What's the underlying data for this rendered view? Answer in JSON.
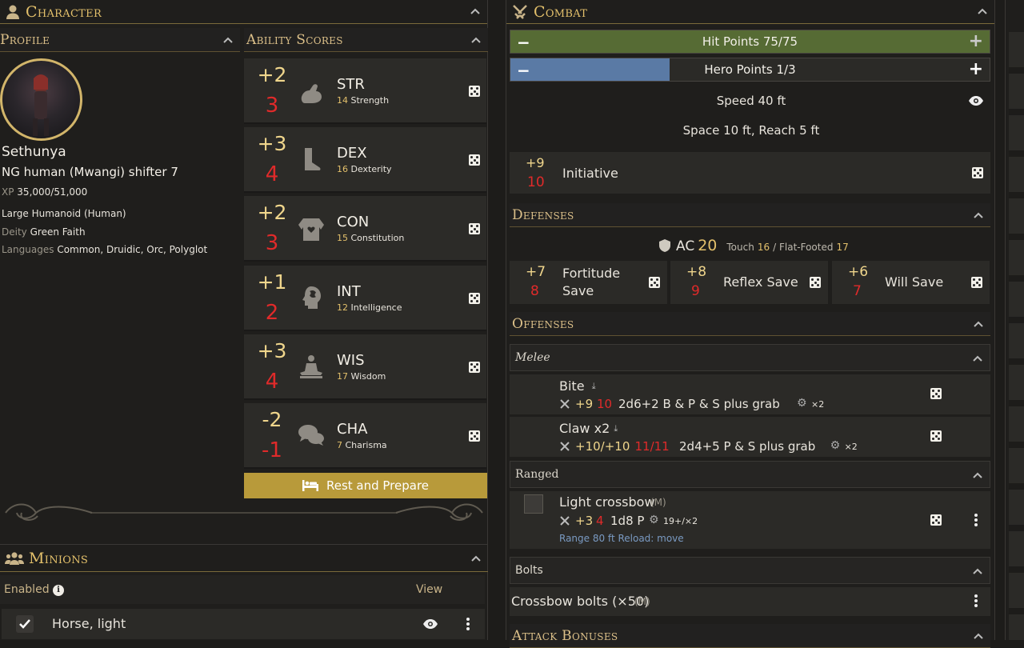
{
  "character": {
    "header": "Character",
    "profile_header": "Profile",
    "abilities_header": "Ability Scores",
    "name": "Sethunya",
    "class_line": "NG human (Mwangi) shifter 7",
    "xp_label": "XP",
    "xp_value": "35,000/51,000",
    "size_type": "Large Humanoid (Human)",
    "deity_label": "Deity",
    "deity_value": "Green Faith",
    "languages_label": "Languages",
    "languages_value": "Common, Druidic, Orc, Polyglot",
    "abilities": [
      {
        "mod": "+2",
        "temp": "3",
        "abbr": "STR",
        "score": "14",
        "name": "Strength",
        "icon": "flexed-arm-icon"
      },
      {
        "mod": "+3",
        "temp": "4",
        "abbr": "DEX",
        "score": "16",
        "name": "Dexterity",
        "icon": "boot-icon"
      },
      {
        "mod": "+2",
        "temp": "3",
        "abbr": "CON",
        "score": "15",
        "name": "Constitution",
        "icon": "torso-heart-icon"
      },
      {
        "mod": "+1",
        "temp": "2",
        "abbr": "INT",
        "score": "12",
        "name": "Intelligence",
        "icon": "head-brain-icon"
      },
      {
        "mod": "+3",
        "temp": "4",
        "abbr": "WIS",
        "score": "17",
        "name": "Wisdom",
        "icon": "meditation-icon"
      },
      {
        "mod": "-2",
        "temp": "-1",
        "abbr": "CHA",
        "score": "7",
        "name": "Charisma",
        "icon": "speech-bubbles-icon"
      }
    ],
    "rest_button": "Rest and Prepare"
  },
  "minions": {
    "header": "Minions",
    "enabled_label": "Enabled",
    "view_label": "View",
    "items": [
      {
        "name": "Horse, light",
        "enabled": true
      }
    ]
  },
  "combat": {
    "header": "Combat",
    "hp_label": "Hit Points 75/75",
    "hp_fraction": 1.0,
    "hero_label": "Hero Points 1/3",
    "hero_fraction": 0.333,
    "speed": "Speed 40 ft",
    "space_reach": "Space 10 ft, Reach 5 ft",
    "initiative": {
      "mod": "+9",
      "temp": "10",
      "label": "Initiative"
    },
    "defenses_header": "Defenses",
    "ac_label": "AC",
    "ac_value": "20",
    "touch_label": "Touch",
    "touch_value": "16",
    "flat_label": "/ Flat-Footed",
    "flat_value": "17",
    "saves": [
      {
        "mod": "+7",
        "temp": "8",
        "label": "Fortitude Save"
      },
      {
        "mod": "+8",
        "temp": "9",
        "label": "Reflex Save"
      },
      {
        "mod": "+6",
        "temp": "7",
        "label": "Will Save"
      }
    ],
    "offenses_header": "Offenses",
    "melee_header": "Melee",
    "melee": [
      {
        "name": "Bite",
        "atk": "+9",
        "atk_temp": "10",
        "damage": "2d6+2 B & P & S plus grab",
        "crit": "×2"
      },
      {
        "name": "Claw x2",
        "atk": "+10/+10",
        "atk_temp": "11/11",
        "damage": "2d4+5 P & S plus grab",
        "crit": "×2"
      }
    ],
    "ranged_header": "Ranged",
    "ranged": [
      {
        "name": "Light crossbow",
        "size": "(M)",
        "atk": "+3",
        "atk_temp": "4",
        "damage": "1d8 P",
        "crit": "19+/×2",
        "range": "Range 80 ft Reload: move"
      }
    ],
    "bolts_header": "Bolts",
    "bolts_item": "Crossbow bolts (×50)",
    "bolts_size": "(M)",
    "attack_bonuses_header": "Attack Bonuses"
  },
  "colors": {
    "accent_gold": "#e3c06b",
    "temp_red": "#e02a2a",
    "hp_green": "#566b34",
    "hero_blue": "#5a7aa5",
    "rest_button": "#b89a3a"
  }
}
